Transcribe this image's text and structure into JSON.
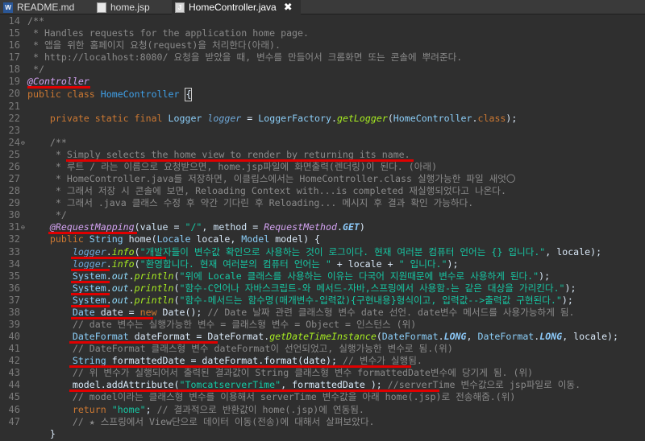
{
  "tabs": [
    {
      "label": "README.md",
      "icon": "word-doc-icon",
      "active": false
    },
    {
      "label": "home.jsp",
      "icon": "file-icon",
      "active": false
    },
    {
      "label": "HomeController.java",
      "icon": "java-file-icon",
      "active": true
    }
  ],
  "tab_close": "✖",
  "line_numbers": [
    "14",
    "15",
    "16",
    "17",
    "18",
    "19",
    "20",
    "21",
    "22",
    "23",
    "24",
    "25",
    "26",
    "27",
    "28",
    "29",
    "30",
    "31",
    "32",
    "33",
    "34",
    "35",
    "36",
    "37",
    "38",
    "39",
    "40",
    "41",
    "42",
    "43",
    "44",
    "45",
    "46",
    "47"
  ],
  "fold_markers": {
    "24": "⊖",
    "31": "⊖"
  },
  "code": [
    [
      [
        "/**",
        "cm"
      ]
    ],
    [
      [
        " * Handles requests for the application home page.",
        "cm"
      ]
    ],
    [
      [
        " * 앱을 위한 홈페이지 요청(request)을 처리한다(아래).",
        "cm"
      ]
    ],
    [
      [
        " * http://localhost:8080/ 요청을 받았을 때, 변수를 만들어서 크롬화면 또는 콘솔에 뿌려준다.",
        "cm"
      ]
    ],
    [
      [
        " */",
        "cm"
      ]
    ],
    [
      [
        "@Controller",
        "a"
      ]
    ],
    [
      [
        "public ",
        "k"
      ],
      [
        "class ",
        "k"
      ],
      [
        "HomeController ",
        "cn"
      ],
      [
        "{",
        "caret"
      ]
    ],
    [
      [
        "",
        ""
      ]
    ],
    [
      [
        "    private ",
        "k"
      ],
      [
        "static ",
        "k"
      ],
      [
        "final ",
        "k"
      ],
      [
        "Logger ",
        "fn"
      ],
      [
        "logger",
        "fi"
      ],
      [
        " = ",
        ""
      ],
      [
        "LoggerFactory",
        "fn"
      ],
      [
        ".",
        ""
      ],
      [
        "getLogger",
        "m"
      ],
      [
        "(",
        ""
      ],
      [
        "HomeController",
        "fn"
      ],
      [
        ".",
        ""
      ],
      [
        "class",
        "k"
      ],
      [
        ");",
        ""
      ]
    ],
    [
      [
        "",
        ""
      ]
    ],
    [
      [
        "    /**",
        "cm"
      ]
    ],
    [
      [
        "     * Simply selects the home view to render by returning its name.",
        "cm"
      ]
    ],
    [
      [
        "     * 루트 / 라는 이름으로 요청받으면, home.jsp파일에 화면출력(렌더링)이 된다. (아래)",
        "cm"
      ]
    ],
    [
      [
        "     * HomeController.java를 저장하면, 이클립스에서는 HomeController.class 실행가능한 파일 새엇〇",
        "cm"
      ]
    ],
    [
      [
        "     * 그래서 저장 시 콘솔에 보면, Reloading Context with...is completed 재실행되었다고 나온다.",
        "cm"
      ]
    ],
    [
      [
        "     * 그래서 .java 클래스 수정 후 약간 기다린 후 Reloading... 메시지 후 결과 확인 가능하다.",
        "cm"
      ]
    ],
    [
      [
        "     */",
        "cm"
      ]
    ],
    [
      [
        "    @RequestMapping",
        "a"
      ],
      [
        "(",
        ""
      ],
      [
        "value",
        "lv"
      ],
      [
        " = ",
        ""
      ],
      [
        "\"/\"",
        "s"
      ],
      [
        ", ",
        ""
      ],
      [
        "method",
        "lv"
      ],
      [
        " = ",
        ""
      ],
      [
        "RequestMethod",
        "a"
      ],
      [
        ".",
        ""
      ],
      [
        "GET",
        "st"
      ],
      [
        ")",
        ""
      ]
    ],
    [
      [
        "    public ",
        "k"
      ],
      [
        "String ",
        "fn"
      ],
      [
        "home(",
        ""
      ],
      [
        "Locale ",
        "fn"
      ],
      [
        "locale",
        ""
      ],
      [
        ", ",
        ""
      ],
      [
        "Model ",
        "fn"
      ],
      [
        "model",
        ""
      ],
      [
        ") {",
        ""
      ]
    ],
    [
      [
        "        ",
        ""
      ],
      [
        "logger",
        "fi"
      ],
      [
        ".",
        ""
      ],
      [
        "info",
        "m"
      ],
      [
        "(",
        ""
      ],
      [
        "\"개발자들이 변수값 확인으로 사용하는 것이 로그이다. 현재 여러분 컴퓨터 언어는 {} 입니다.\"",
        "s"
      ],
      [
        ", locale);",
        ""
      ]
    ],
    [
      [
        "        ",
        ""
      ],
      [
        "logger",
        "fi"
      ],
      [
        ".",
        ""
      ],
      [
        "info",
        "m"
      ],
      [
        "(",
        ""
      ],
      [
        "\"환영합니다. 현재 여러분의 컴퓨터 언어는 \"",
        "s"
      ],
      [
        " + locale + ",
        ""
      ],
      [
        "\" 입니다.\"",
        "s"
      ],
      [
        ");",
        ""
      ]
    ],
    [
      [
        "        ",
        ""
      ],
      [
        "System",
        "fn"
      ],
      [
        ".",
        ""
      ],
      [
        "out",
        "sm"
      ],
      [
        ".",
        ""
      ],
      [
        "println",
        "m"
      ],
      [
        "(",
        ""
      ],
      [
        "\"위에 Locale 클래스를 사용하는 이유는 다국어 지원때문에 변수로 사용하게 된다.\"",
        "s"
      ],
      [
        ");",
        ""
      ]
    ],
    [
      [
        "        ",
        ""
      ],
      [
        "System",
        "fn"
      ],
      [
        ".",
        ""
      ],
      [
        "out",
        "sm"
      ],
      [
        ".",
        ""
      ],
      [
        "println",
        "m"
      ],
      [
        "(",
        ""
      ],
      [
        "\"함수-C언어나 자바스크립트-와 메서드-자바,스프링에서 사용함-는 같은 대상을 가리킨다.\"",
        "s"
      ],
      [
        ");",
        ""
      ]
    ],
    [
      [
        "        ",
        ""
      ],
      [
        "System",
        "fn"
      ],
      [
        ".",
        ""
      ],
      [
        "out",
        "sm"
      ],
      [
        ".",
        ""
      ],
      [
        "println",
        "m"
      ],
      [
        "(",
        ""
      ],
      [
        "\"함수-메서드는 함수명(매개변수-입력값){구현내용}형식이고, 입력값-->출력값 구현된다.\"",
        "s"
      ],
      [
        ");",
        ""
      ]
    ],
    [
      [
        "        ",
        ""
      ],
      [
        "Date ",
        "fn"
      ],
      [
        "date",
        ""
      ],
      [
        " = ",
        ""
      ],
      [
        "new ",
        "k"
      ],
      [
        "Date",
        ""
      ],
      [
        "(); ",
        ""
      ],
      [
        "// Date 날짜 관련 클래스형 변수 date 선언. date변수 메서드를 사용가능하게 됨.",
        "cm"
      ]
    ],
    [
      [
        "        // date 변수는 실행가능한 변수 = 클래스형 변수 = Object = 인스턴스 (위)",
        "cm"
      ]
    ],
    [
      [
        "        ",
        ""
      ],
      [
        "DateFormat ",
        "fn"
      ],
      [
        "dateFormat",
        ""
      ],
      [
        " = ",
        ""
      ],
      [
        "DateFormat",
        ""
      ],
      [
        ".",
        ""
      ],
      [
        "getDateTimeInstance",
        "m"
      ],
      [
        "(",
        ""
      ],
      [
        "DateFormat",
        "fn"
      ],
      [
        ".",
        ""
      ],
      [
        "LONG",
        "st"
      ],
      [
        ", ",
        ""
      ],
      [
        "DateFormat",
        "fn"
      ],
      [
        ".",
        ""
      ],
      [
        "LONG",
        "st"
      ],
      [
        ", locale);",
        ""
      ]
    ],
    [
      [
        "        // DateFormat 클래스형 변수 dateFormat이 선언되었고, 실행가능한 변수로 됨.(위)",
        "cm"
      ]
    ],
    [
      [
        "        ",
        ""
      ],
      [
        "String ",
        "fn"
      ],
      [
        "formattedDate",
        ""
      ],
      [
        " = ",
        ""
      ],
      [
        "dateFormat",
        ""
      ],
      [
        ".",
        ""
      ],
      [
        "format",
        ""
      ],
      [
        "(",
        ""
      ],
      [
        "date",
        ""
      ],
      [
        "); ",
        ""
      ],
      [
        "// 변수가 실행됨.",
        "cm"
      ]
    ],
    [
      [
        "        // 위 변수가 실행되어서 출력된 결과값이 String 클래스형 변수 formattedDate변수에 당기게 됨. (위)",
        "cm"
      ]
    ],
    [
      [
        "        ",
        ""
      ],
      [
        "model",
        ""
      ],
      [
        ".",
        ""
      ],
      [
        "addAttribute",
        ""
      ],
      [
        "(",
        ""
      ],
      [
        "\"TomcatserverTime\"",
        "s"
      ],
      [
        ", ",
        ""
      ],
      [
        "formattedDate",
        ""
      ],
      [
        " ); ",
        ""
      ],
      [
        "//serverTime 변수값으로 jsp파일로 이동.",
        "cm"
      ]
    ],
    [
      [
        "        // model이라는 클래스형 변수를 이용해서 serverTime 변수값을 아래 home(.jsp)로 전송해줌.(위)",
        "cm"
      ]
    ],
    [
      [
        "        ",
        ""
      ],
      [
        "return ",
        "k"
      ],
      [
        "\"home\"",
        "s"
      ],
      [
        "; ",
        ""
      ],
      [
        "// 결과적으로 반환값이 home(.jsp)에 연동됨.",
        "cm"
      ]
    ],
    [
      [
        "        // ★ 스프링에서 View단으로 데이터 이동(전송)에 대해서 살펴보았다.",
        "cm"
      ]
    ],
    [
      [
        "    }",
        ""
      ]
    ]
  ]
}
